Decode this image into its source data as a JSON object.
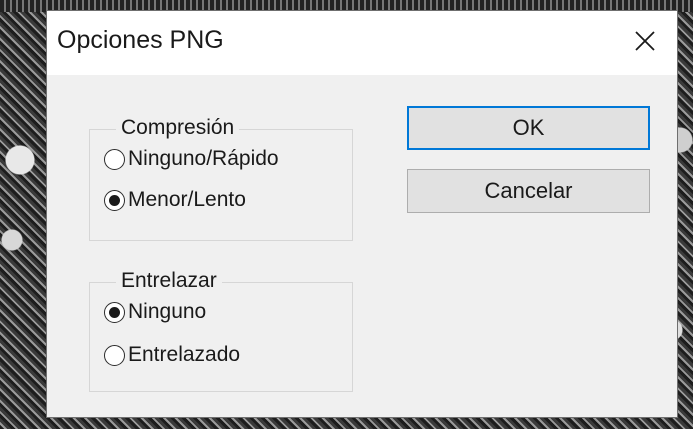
{
  "window": {
    "title": "Opciones PNG",
    "close_icon": "close-icon"
  },
  "compression": {
    "legend": "Compresión",
    "options": [
      {
        "label": "Ninguno/Rápido",
        "selected": false
      },
      {
        "label": "Menor/Lento",
        "selected": true
      }
    ]
  },
  "interlace": {
    "legend": "Entrelazar",
    "options": [
      {
        "label": "Ninguno",
        "selected": true
      },
      {
        "label": "Entrelazado",
        "selected": false
      }
    ]
  },
  "buttons": {
    "ok_label": "OK",
    "cancel_label": "Cancelar"
  },
  "colors": {
    "dialog_bg": "#f0f0f0",
    "titlebar_bg": "#ffffff",
    "default_button_border": "#0078d7"
  }
}
